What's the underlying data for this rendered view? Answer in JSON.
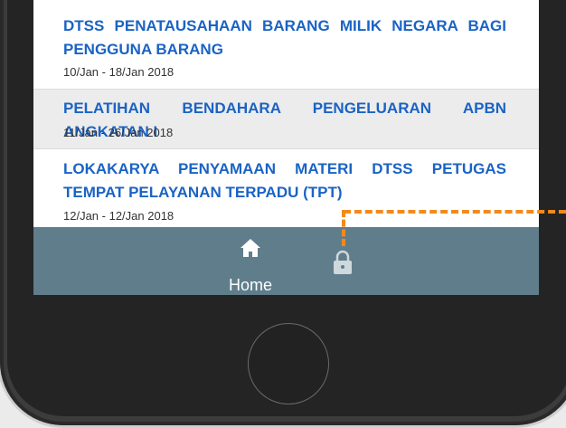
{
  "list": [
    {
      "title": "DTSS PENATAUSAHAAN BARANG MILIK NEGARA BAGI PENGGUNA BARANG",
      "date": "10/Jan - 18/Jan 2018"
    },
    {
      "title": "PELATIHAN BENDAHARA PENGELUARAN APBN ANGKATAN I",
      "date": "11/Jan - 26/Jan 2018"
    },
    {
      "title": "LOKAKARYA PENYAMAAN MATERI DTSS PETUGAS TEMPAT PELAYANAN TERPADU (TPT)",
      "date": "12/Jan - 12/Jan 2018"
    }
  ],
  "nav": {
    "home_label": "Home",
    "home_icon": "home-icon",
    "lock_icon": "lock-icon"
  },
  "colors": {
    "title": "#1a63c4",
    "nav_bar": "#607d8b",
    "callout": "#f28a1c"
  }
}
